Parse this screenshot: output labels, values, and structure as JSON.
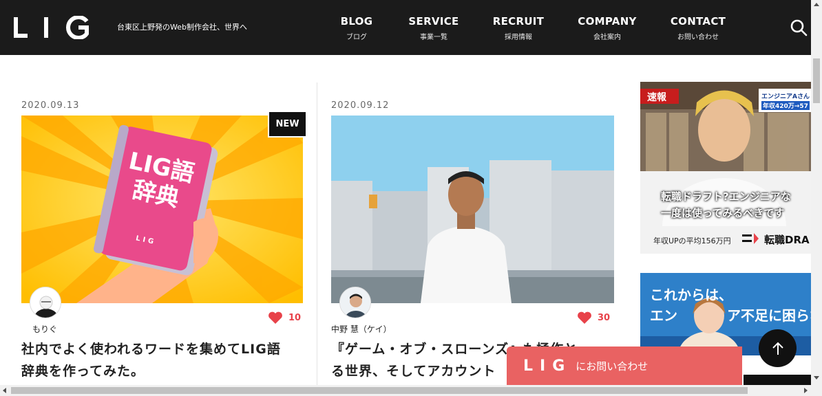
{
  "header": {
    "logo": "LIG",
    "tagline": "台東区上野発のWeb制作会社、世界へ",
    "nav": [
      {
        "en": "BLOG",
        "jp": "ブログ"
      },
      {
        "en": "SERVICE",
        "jp": "事業一覧"
      },
      {
        "en": "RECRUIT",
        "jp": "採用情報"
      },
      {
        "en": "COMPANY",
        "jp": "会社案内"
      },
      {
        "en": "CONTACT",
        "jp": "お問い合わせ"
      }
    ],
    "search_icon": "search-icon"
  },
  "articles": [
    {
      "date": "2020.09.13",
      "badge": "NEW",
      "book_text_1": "LIG語",
      "book_text_2": "辞典",
      "book_logo": "LIG",
      "author": "もりぐ",
      "likes": "10",
      "title_line1": "社内でよく使われるワードを集めてLIG語",
      "title_line2": "辞典を作ってみた。"
    },
    {
      "date": "2020.09.12",
      "author": "中野 慧（ケイ）",
      "likes": "30",
      "title_line1": "『ゲーム・オブ・スローンズ』も極作と",
      "title_line2": "る世界、そしてアカウント"
    }
  ],
  "ads": {
    "ad1": {
      "badge": "速報",
      "caption_top": "エンジニアAさん",
      "caption_salary": "年収420万→57",
      "overlay_line1": "転職ドラフト?エンジニアな",
      "overlay_line2": "一度は使ってみるべきです",
      "footer_left": "年収UPの平均156万円",
      "footer_right": "転職DRA"
    },
    "ad2": {
      "line1": "これからは、",
      "line2": "エン",
      "line2b": "ア不足に困らな"
    }
  },
  "floating": {
    "contact_logo": "LIG",
    "contact_text": "にお問い合わせ",
    "to_top_icon": "arrow-up-icon"
  },
  "colors": {
    "header_bg": "#1b1b1b",
    "accent_red": "#e8424a",
    "contact_bg": "#e96262",
    "ad_blue": "#2e80c9"
  }
}
